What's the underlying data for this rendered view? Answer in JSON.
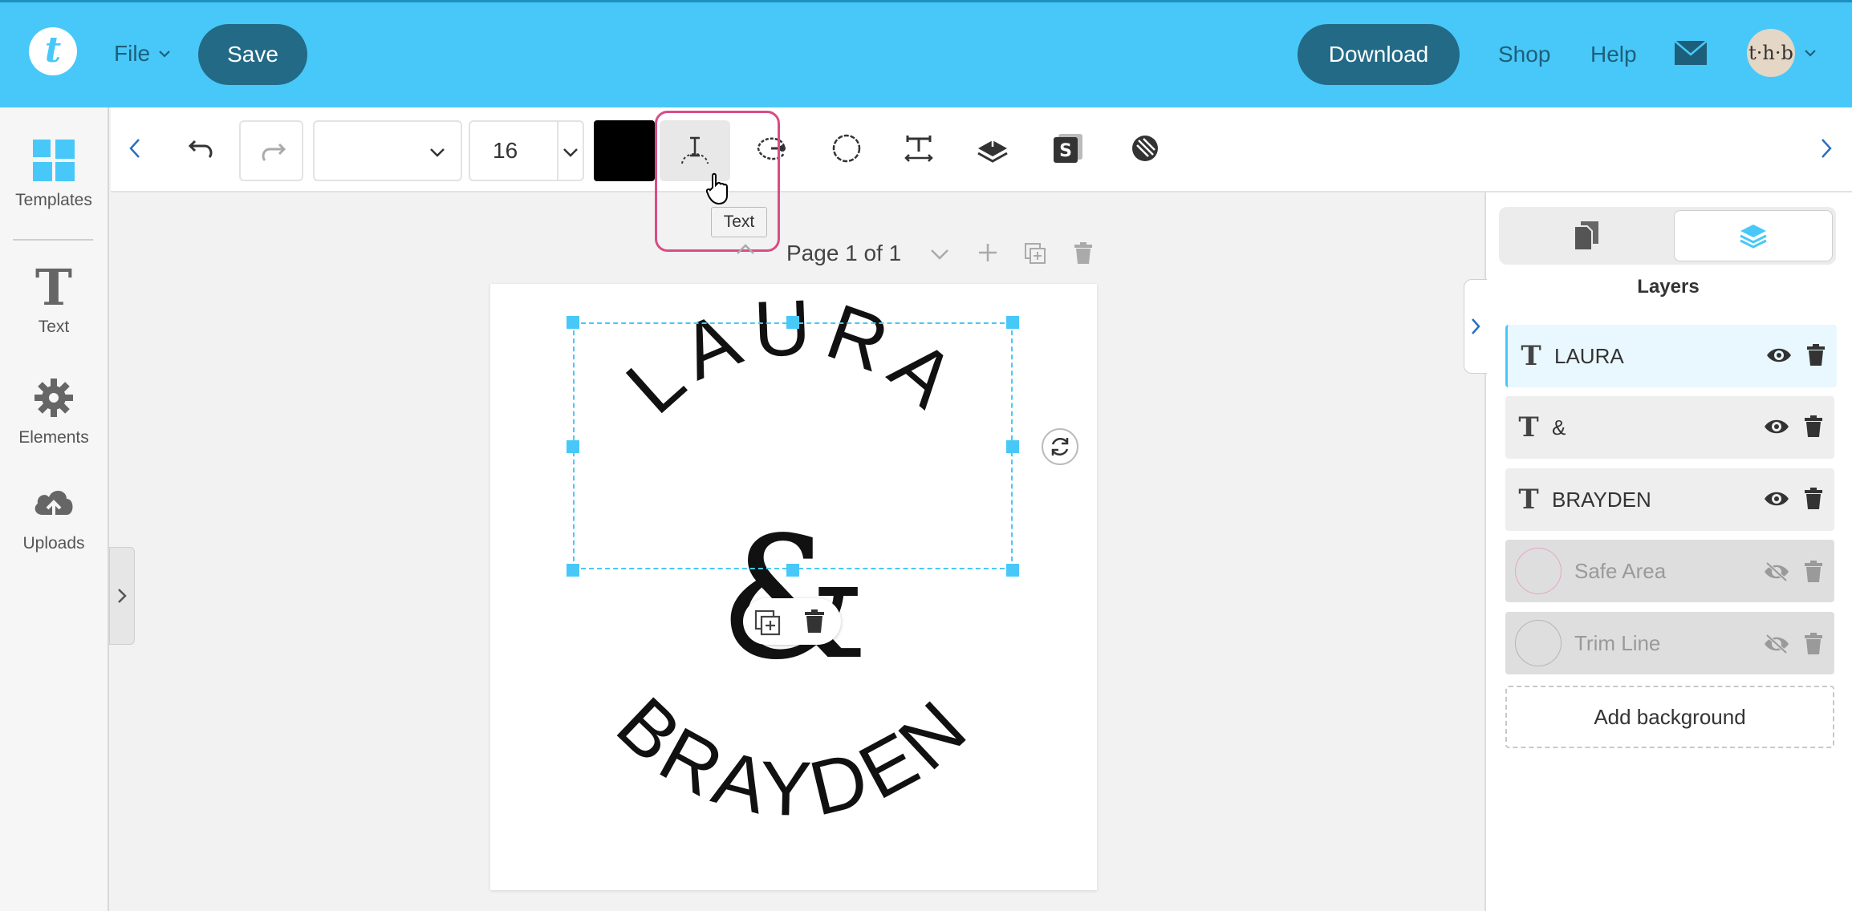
{
  "header": {
    "logo_letter": "t",
    "file_label": "File",
    "save_label": "Save",
    "download_label": "Download",
    "shop_label": "Shop",
    "help_label": "Help",
    "avatar_text": "t·h·b"
  },
  "sidebar": {
    "items": [
      {
        "label": "Templates",
        "icon": "templates-icon"
      },
      {
        "label": "Text",
        "icon": "text-icon"
      },
      {
        "label": "Elements",
        "icon": "gear-icon"
      },
      {
        "label": "Uploads",
        "icon": "cloud-upload-icon"
      }
    ]
  },
  "toolbar": {
    "font_name": "",
    "font_size": "16",
    "text_color": "#000000",
    "tooltip": "Text"
  },
  "page_nav": {
    "label": "Page 1 of 1"
  },
  "canvas": {
    "top_text": "LAURA",
    "ampersand": "&",
    "bottom_text": "BRAYDEN"
  },
  "right_panel": {
    "title": "Layers",
    "layers": [
      {
        "name": "LAURA",
        "type": "text",
        "visible": true,
        "selected": true
      },
      {
        "name": "&",
        "type": "text",
        "visible": true,
        "selected": false
      },
      {
        "name": "BRAYDEN",
        "type": "text",
        "visible": true,
        "selected": false
      },
      {
        "name": "Safe Area",
        "type": "guide",
        "visible": false,
        "selected": false
      },
      {
        "name": "Trim Line",
        "type": "guide",
        "visible": false,
        "selected": false
      }
    ],
    "add_background_label": "Add background"
  },
  "colors": {
    "header_bg": "#48c8f8",
    "button_bg": "#236a86",
    "selection": "#48c8f8",
    "tooltip_highlight": "#d94c86"
  }
}
